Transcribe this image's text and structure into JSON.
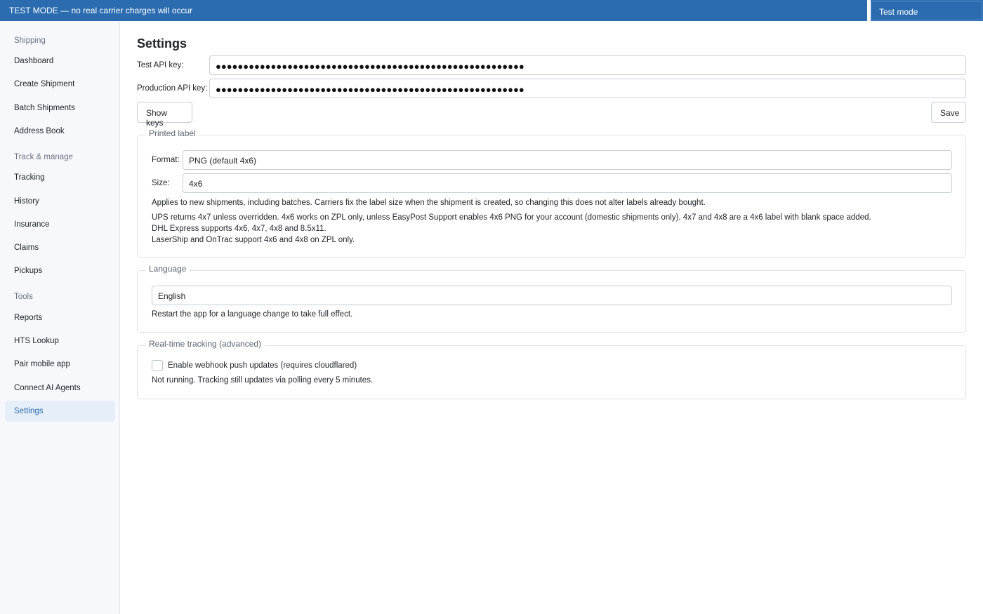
{
  "banner": {
    "text": "TEST MODE — no real carrier charges will occur",
    "mode_select": "Test mode"
  },
  "sidebar": {
    "groups": [
      {
        "label": "Shipping",
        "items": [
          "Dashboard",
          "Create Shipment",
          "Batch Shipments",
          "Address Book"
        ]
      },
      {
        "label": "Track & manage",
        "items": [
          "Tracking",
          "History",
          "Insurance",
          "Claims",
          "Pickups"
        ]
      },
      {
        "label": "Tools",
        "items": [
          "Reports",
          "HTS Lookup",
          "Pair mobile app",
          "Connect AI Agents",
          "Settings"
        ]
      }
    ],
    "active_item": "Settings"
  },
  "settings": {
    "title": "Settings",
    "test_key_label": "Test API key:",
    "test_key_value": "●●●●●●●●●●●●●●●●●●●●●●●●●●●●●●●●●●●●●●●●●●●●●●●●●●●●●●●●",
    "prod_key_label": "Production API key:",
    "prod_key_value": "●●●●●●●●●●●●●●●●●●●●●●●●●●●●●●●●●●●●●●●●●●●●●●●●●●●●●●●●",
    "show_keys_label": "Show keys",
    "save_label": "Save"
  },
  "printed_label": {
    "legend": "Printed label",
    "format_label": "Format:",
    "format_value": "PNG (default 4x6)",
    "size_label": "Size:",
    "size_value": "4x6",
    "help_1": "Applies to new shipments, including batches. Carriers fix the label size when the shipment is created, so changing this does not alter labels already bought.",
    "help_2": "UPS returns 4x7 unless overridden. 4x6 works on ZPL only, unless EasyPost Support enables 4x6 PNG for your account (domestic shipments only). 4x7 and 4x8 are a 4x6 label with blank space added.",
    "help_3": "DHL Express supports 4x6, 4x7, 4x8 and 8.5x11.",
    "help_4": "LaserShip and OnTrac support 4x6 and 4x8 on ZPL only."
  },
  "language": {
    "legend": "Language",
    "value": "English",
    "help": "Restart the app for a language change to take full effect."
  },
  "tracking": {
    "legend": "Real-time tracking (advanced)",
    "checkbox_label": "Enable webhook push updates (requires cloudflared)",
    "checked": false,
    "status": "Not running. Tracking still updates via polling every 5 minutes."
  }
}
